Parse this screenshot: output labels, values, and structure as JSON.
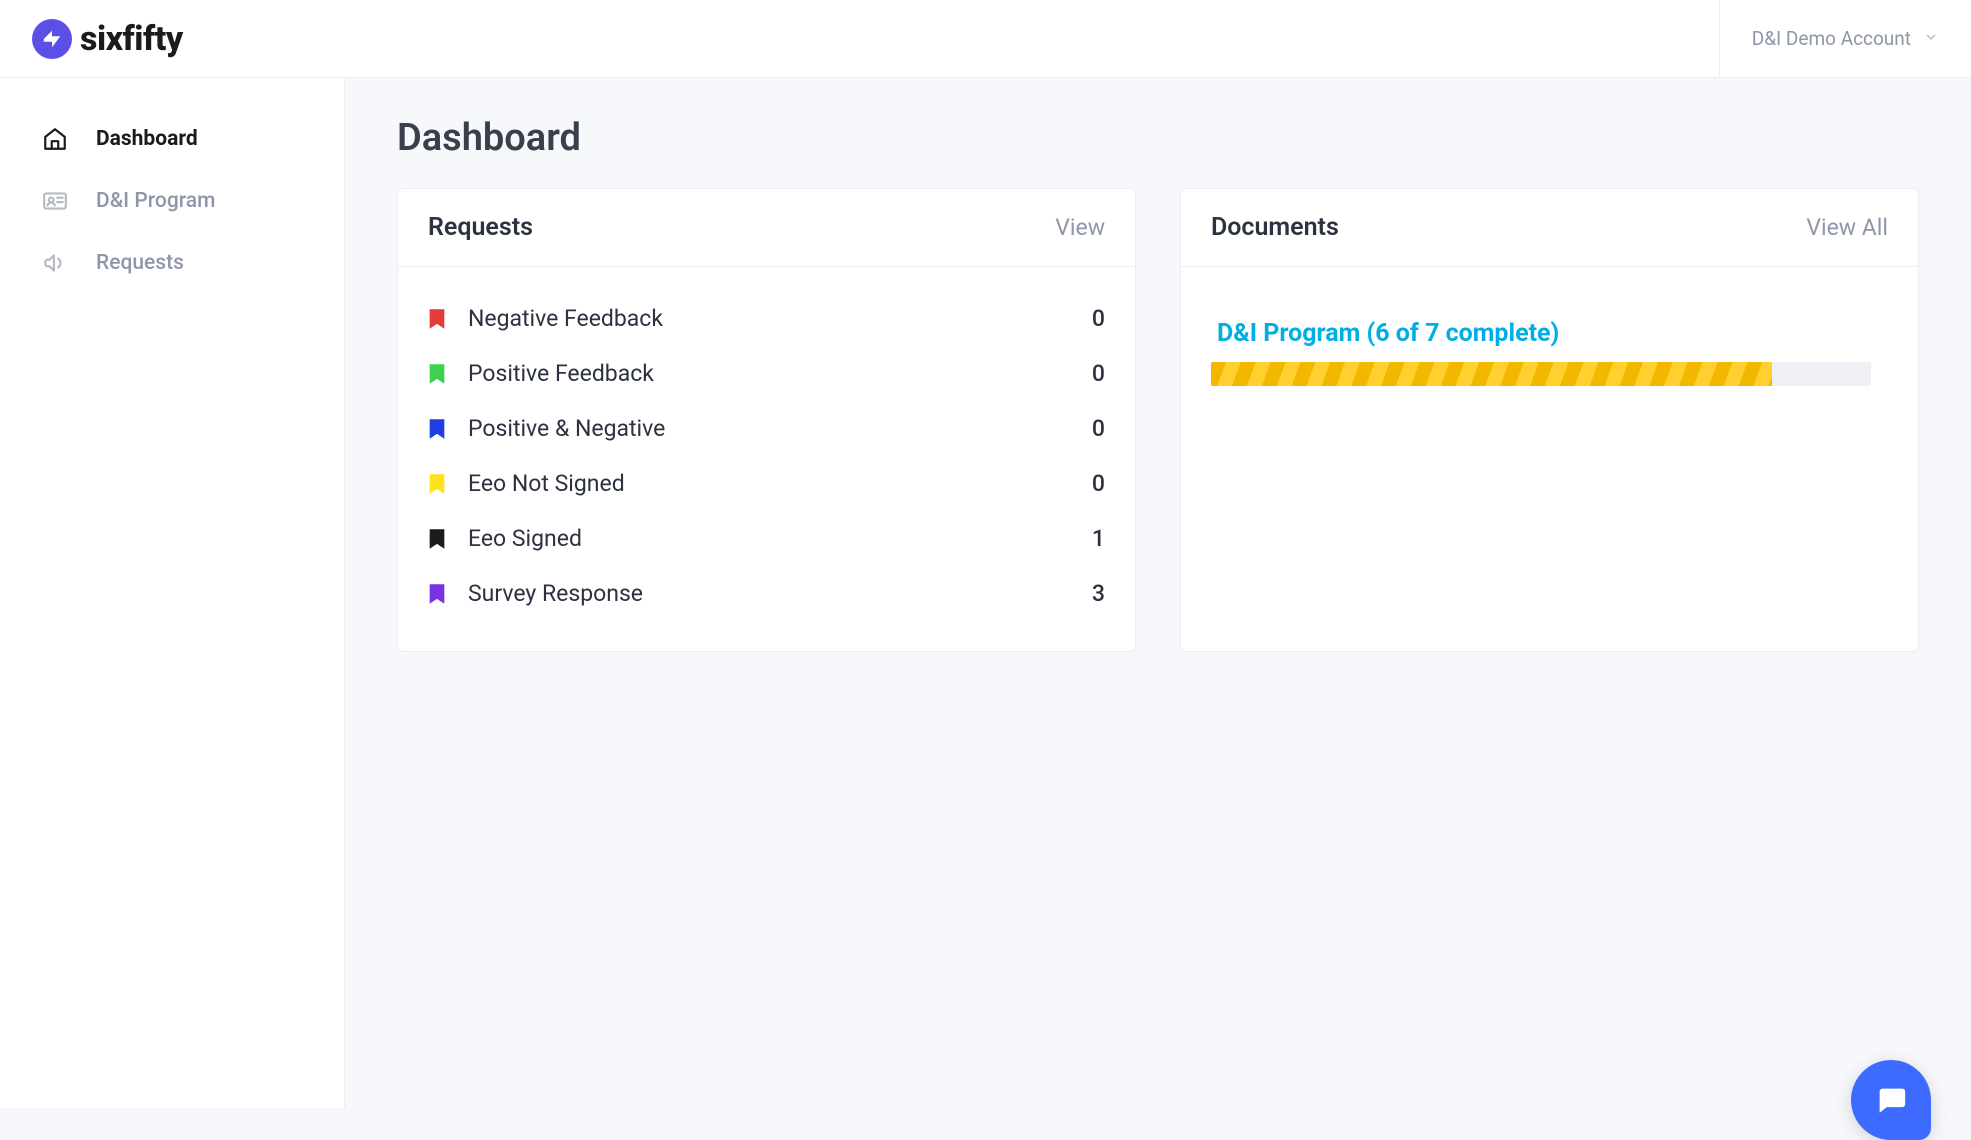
{
  "brand": {
    "name": "sixfifty"
  },
  "account": {
    "label": "D&I Demo Account"
  },
  "sidebar": {
    "items": [
      {
        "label": "Dashboard",
        "icon": "home",
        "active": true
      },
      {
        "label": "D&I Program",
        "icon": "id-card",
        "active": false
      },
      {
        "label": "Requests",
        "icon": "megaphone",
        "active": false
      }
    ]
  },
  "page": {
    "title": "Dashboard"
  },
  "requests_card": {
    "title": "Requests",
    "action": "View",
    "items": [
      {
        "label": "Negative Feedback",
        "count": "0",
        "color": "#e33a3a"
      },
      {
        "label": "Positive Feedback",
        "count": "0",
        "color": "#3ed04f"
      },
      {
        "label": "Positive & Negative",
        "count": "0",
        "color": "#1f3fe0"
      },
      {
        "label": "Eeo Not Signed",
        "count": "0",
        "color": "#ffe21a"
      },
      {
        "label": "Eeo Signed",
        "count": "1",
        "color": "#1b1b1b"
      },
      {
        "label": "Survey Response",
        "count": "3",
        "color": "#7a33e0"
      }
    ]
  },
  "documents_card": {
    "title": "Documents",
    "action": "View All",
    "program_label": "D&I Program (6 of 7 complete)",
    "progress_percent": 85
  }
}
